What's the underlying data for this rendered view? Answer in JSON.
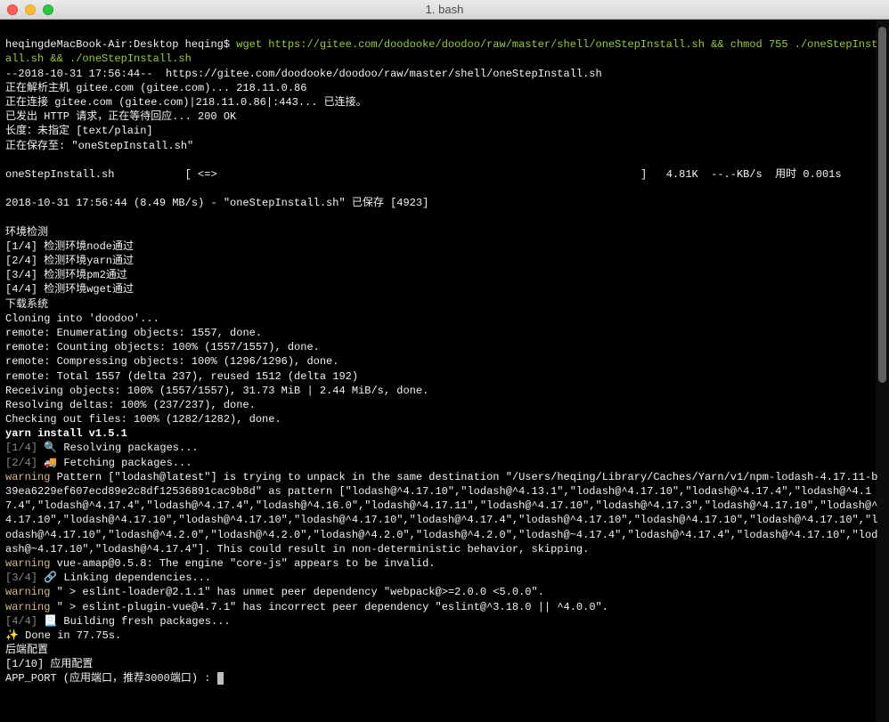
{
  "titlebar": {
    "title": "1. bash"
  },
  "terminal": {
    "prompt_host": "heqingdeMacBook-Air:Desktop heqing$ ",
    "command": "wget https://gitee.com/doodooke/doodoo/raw/master/shell/oneStepInstall.sh && chmod 755 ./oneStepInstall.sh && ./oneStepInstall.sh",
    "wget_start": "--2018-10-31 17:56:44--  https://gitee.com/doodooke/doodoo/raw/master/shell/oneStepInstall.sh",
    "wget_resolve": "正在解析主机 gitee.com (gitee.com)... 218.11.0.86",
    "wget_connect": "正在连接 gitee.com (gitee.com)|218.11.0.86|:443... 已连接。",
    "wget_http": "已发出 HTTP 请求，正在等待回应... 200 OK",
    "wget_length": "长度：未指定 [text/plain]",
    "wget_saving": "正在保存至: \"oneStepInstall.sh\"",
    "wget_progress_name": "oneStepInstall.sh",
    "wget_progress_left": "[ <=>",
    "wget_progress_right": "]   4.81K  --.-KB/s  用时 0.001s",
    "wget_done": "2018-10-31 17:56:44 (8.49 MB/s) - \"oneStepInstall.sh\" 已保存 [4923]",
    "env_check": "环境检测",
    "env_1": "[1/4] 检测环境node通过",
    "env_2": "[2/4] 检测环境yarn通过",
    "env_3": "[3/4] 检测环境pm2通过",
    "env_4": "[4/4] 检测环境wget通过",
    "download_sys": "下载系统",
    "clone": "Cloning into 'doodoo'...",
    "remote_enum": "remote: Enumerating objects: 1557, done.",
    "remote_count": "remote: Counting objects: 100% (1557/1557), done.",
    "remote_compress": "remote: Compressing objects: 100% (1296/1296), done.",
    "remote_total": "remote: Total 1557 (delta 237), reused 1512 (delta 192)",
    "receiving": "Receiving objects: 100% (1557/1557), 31.73 MiB | 2.44 MiB/s, done.",
    "resolving": "Resolving deltas: 100% (237/237), done.",
    "checkout": "Checking out files: 100% (1282/1282), done.",
    "yarn_install": "yarn install v1.5.1",
    "step1_n": "[1/4]",
    "step1_icon": "🔍",
    "step1_t": " Resolving packages...",
    "step2_n": "[2/4]",
    "step2_icon": "🚚",
    "step2_t": " Fetching packages...",
    "warn_label": "warning",
    "warn_lodash": " Pattern [\"lodash@latest\"] is trying to unpack in the same destination \"/Users/heqing/Library/Caches/Yarn/v1/npm-lodash-4.17.11-b39ea6229ef607ecd89e2c8df12536891cac9b8d\" as pattern [\"lodash@^4.17.10\",\"lodash@^4.13.1\",\"lodash@^4.17.10\",\"lodash@^4.17.4\",\"lodash@^4.17.4\",\"lodash@^4.17.4\",\"lodash@^4.17.4\",\"lodash@^4.16.0\",\"lodash@^4.17.11\",\"lodash@^4.17.10\",\"lodash@^4.17.3\",\"lodash@^4.17.10\",\"lodash@^4.17.10\",\"lodash@^4.17.10\",\"lodash@^4.17.10\",\"lodash@^4.17.10\",\"lodash@^4.17.4\",\"lodash@^4.17.10\",\"lodash@^4.17.10\",\"lodash@^4.17.10\",\"lodash@^4.17.10\",\"lodash@^4.2.0\",\"lodash@^4.2.0\",\"lodash@^4.2.0\",\"lodash@^4.2.0\",\"lodash@~4.17.4\",\"lodash@^4.17.4\",\"lodash@^4.17.10\",\"lodash@~4.17.10\",\"lodash@^4.17.4\"]. This could result in non-deterministic behavior, skipping.",
    "warn_vueamap": " vue-amap@0.5.8: The engine \"core-js\" appears to be invalid.",
    "step3_n": "[3/4]",
    "step3_icon": "🔗",
    "step3_t": " Linking dependencies...",
    "warn_eslint_loader": " \" > eslint-loader@2.1.1\" has unmet peer dependency \"webpack@>=2.0.0 <5.0.0\".",
    "warn_eslint_vue": " \" > eslint-plugin-vue@4.7.1\" has incorrect peer dependency \"eslint@^3.18.0 || ^4.0.0\".",
    "step4_n": "[4/4]",
    "step4_icon": "📃",
    "step4_t": " Building fresh packages...",
    "done_icon": "✨",
    "done_t": " Done in 77.75s.",
    "backend_cfg": "后端配置",
    "cfg_1": "[1/10] 应用配置",
    "app_port": "APP_PORT (应用端口，推荐3000端口) : "
  }
}
